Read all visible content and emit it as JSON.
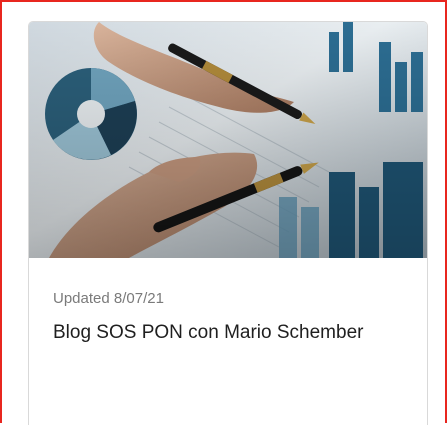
{
  "card": {
    "updated": "Updated 8/07/21",
    "title": "Blog SOS PON con Mario Schember",
    "image_alt": "Hands holding pens over printed financial charts and reports"
  },
  "colors": {
    "border_highlight": "#e8261f",
    "card_border": "#d9d9d9",
    "meta_text": "#7a7a7a",
    "title_text": "#1f1f1f"
  }
}
